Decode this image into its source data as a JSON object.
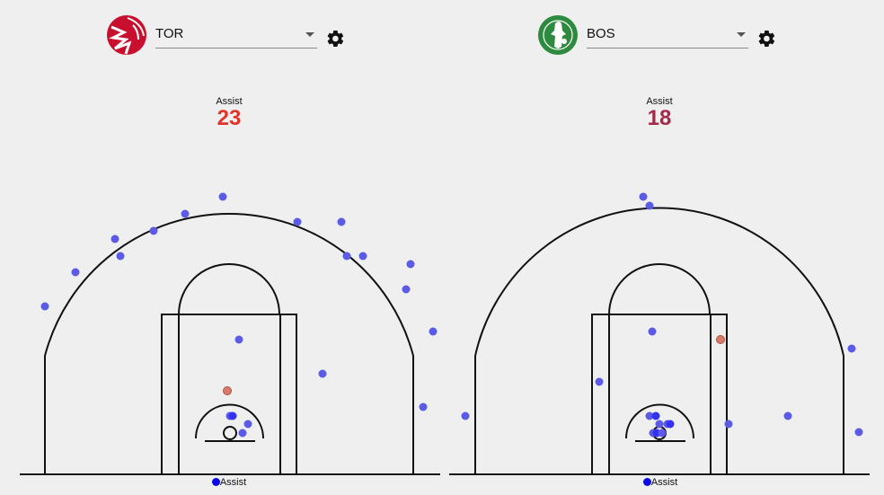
{
  "teams": [
    {
      "abbr": "TOR",
      "logo_icon": "raptors-logo-icon",
      "stat_label": "Assist",
      "stat_value": "23",
      "stat_color": "#e0342a",
      "legend_label": "Assist"
    },
    {
      "abbr": "BOS",
      "logo_icon": "celtics-logo-icon",
      "stat_label": "Assist",
      "stat_value": "18",
      "stat_color": "#a32a4a",
      "legend_label": "Assist"
    }
  ],
  "colors": {
    "shot": "#5b5be8",
    "shot_highlight": "#d97b6a",
    "legend_dot": "#0a0ae6",
    "raptors_red": "#c8102e",
    "celtics_green": "#2d8a3e"
  }
}
